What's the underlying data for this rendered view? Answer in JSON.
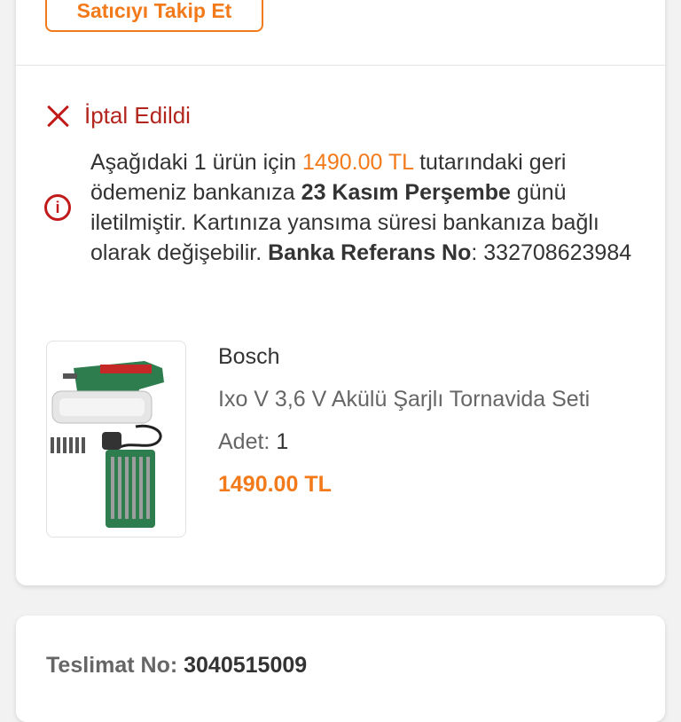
{
  "seller": {
    "follow_label": "Satıcıyı Takip Et"
  },
  "order_status": {
    "label": "İptal Edildi",
    "icon": "close-icon",
    "color": "#b3261e"
  },
  "refund_info": {
    "part1": "Aşağıdaki 1 ürün için ",
    "amount": "1490.00 TL",
    "part2": " tutarındaki geri ödemeniz bankanıza ",
    "date": "23 Kasım Perşembe",
    "part3": " günü iletilmiştir. Kartınıza yansıma süresi bankanıza bağlı olarak değişebilir. ",
    "ref_label": "Banka Referans No",
    "ref_sep": ": ",
    "ref_value": "332708623984"
  },
  "product": {
    "brand": "Bosch",
    "name": "Ixo V 3,6 V Akülü Şarjlı Tornavida Seti",
    "qty_label": "Adet: ",
    "qty_value": "1",
    "price": "1490.00 TL"
  },
  "delivery": {
    "label": "Teslimat No: ",
    "value": "3040515009"
  },
  "colors": {
    "accent": "#f27a1a",
    "cancel_red": "#c11a1a"
  }
}
